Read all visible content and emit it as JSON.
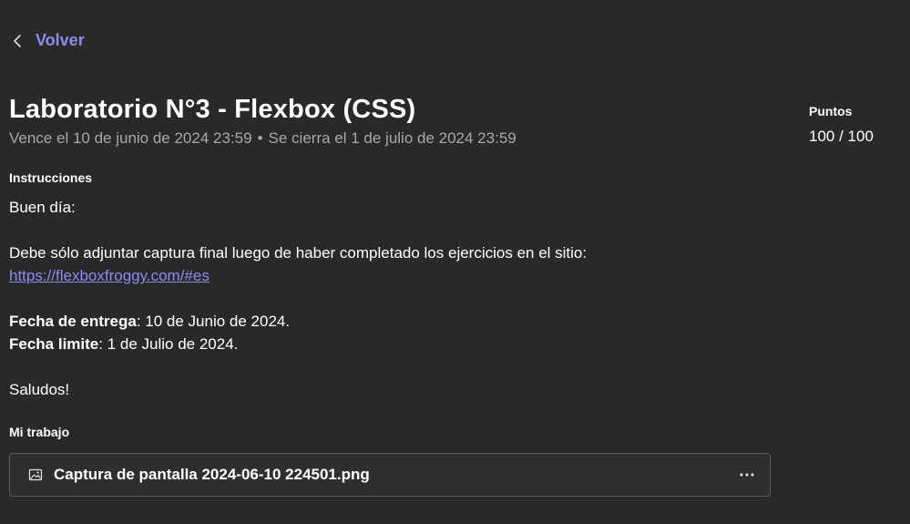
{
  "nav": {
    "back_label": "Volver",
    "back_icon": "chevron-left-icon"
  },
  "assignment": {
    "title": "Laboratorio N°3 - Flexbox (CSS)",
    "due": "Vence el 10 de junio de 2024 23:59",
    "separator": "•",
    "closes": "Se cierra el 1 de julio de 2024 23:59"
  },
  "points": {
    "label": "Puntos",
    "value": "100 / 100"
  },
  "instructions": {
    "label": "Instrucciones",
    "greeting": "Buen día:",
    "body": "Debe sólo adjuntar captura final luego  de haber completado los ejercicios en el sitio:",
    "link": "https://flexboxfroggy.com/#es",
    "due_label": "Fecha de entrega",
    "due_value": ": 10 de Junio de 2024.",
    "limit_label": "Fecha limite",
    "limit_value": ": 1 de Julio de 2024.",
    "closing": "Saludos!"
  },
  "my_work": {
    "label": "Mi trabajo",
    "file_name": "Captura de pantalla 2024-06-10 224501.png",
    "file_icon": "image-file-icon",
    "more_icon": "more-options-icon"
  },
  "colors": {
    "background": "#292929",
    "accent": "#8b8cf0",
    "muted_text": "#a8a8a8",
    "card_border": "#5c5c5c"
  }
}
